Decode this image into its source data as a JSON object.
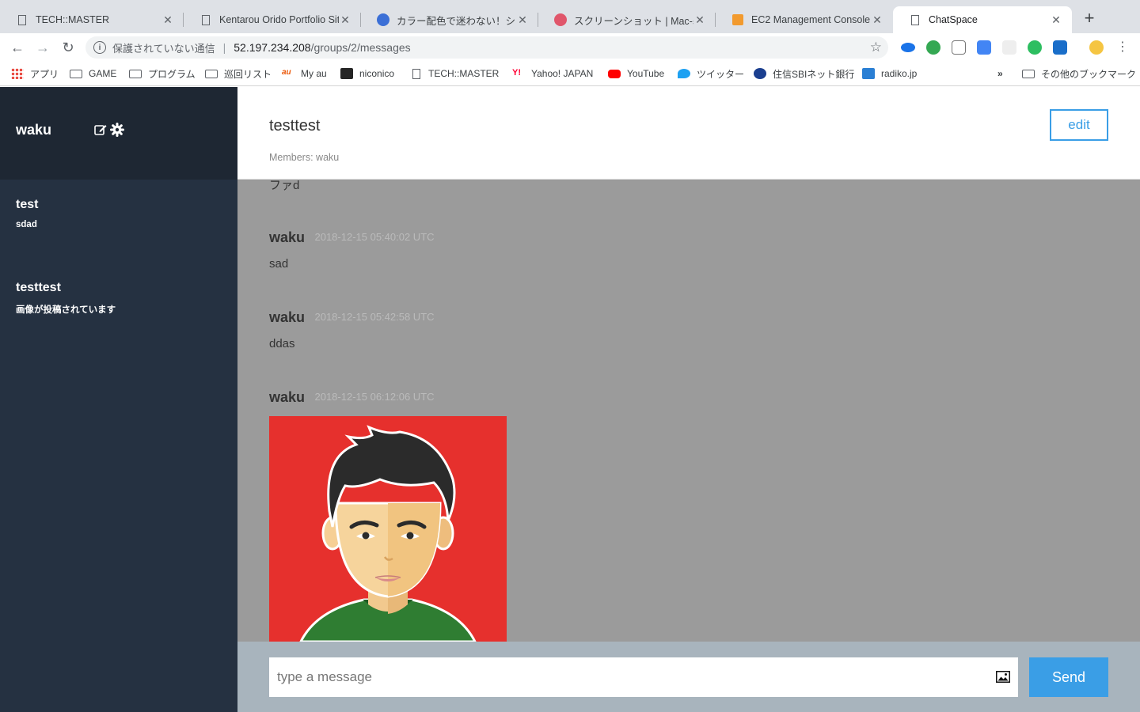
{
  "browser": {
    "tabs": [
      {
        "title": "TECH::MASTER",
        "active": false
      },
      {
        "title": "Kentarou Orido Portfolio Site",
        "active": false
      },
      {
        "title": "カラー配色で迷わない！シーン別",
        "active": false
      },
      {
        "title": "スクリーンショット | Mac-基本",
        "active": false
      },
      {
        "title": "EC2 Management Console",
        "active": false
      },
      {
        "title": "ChatSpace",
        "active": true
      }
    ],
    "security_label": "保護されていない通信",
    "url_host": "52.197.234.208",
    "url_path": "/groups/2/messages",
    "bookmarks": [
      {
        "label": "アプリ",
        "icon": "apps-grid-icon"
      },
      {
        "label": "GAME",
        "icon": "folder-icon"
      },
      {
        "label": "プログラム",
        "icon": "folder-icon"
      },
      {
        "label": "巡回リスト",
        "icon": "folder-icon"
      },
      {
        "label": "My au",
        "icon": "au-icon"
      },
      {
        "label": "niconico",
        "icon": "niconico-icon"
      },
      {
        "label": "TECH::MASTER",
        "icon": "page-icon"
      },
      {
        "label": "Yahoo! JAPAN",
        "icon": "yahoo-icon"
      },
      {
        "label": "YouTube",
        "icon": "youtube-icon"
      },
      {
        "label": "ツイッター",
        "icon": "twitter-icon"
      },
      {
        "label": "住信SBIネット銀行",
        "icon": "bank-icon"
      },
      {
        "label": "radiko.jp",
        "icon": "radiko-icon"
      }
    ],
    "overflow_label": "»",
    "other_bookmarks": "その他のブックマーク"
  },
  "sidebar": {
    "user_name": "waku",
    "groups": [
      {
        "name": "test",
        "last_message": "sdad"
      },
      {
        "name": "testtest",
        "last_message": "画像が投稿されています"
      }
    ]
  },
  "chat": {
    "group_name": "testtest",
    "members_label": "Members: waku",
    "edit_label": "edit",
    "partial_top_text": "ファd",
    "messages": [
      {
        "user": "waku",
        "date": "2018-12-15 05:40:02 UTC",
        "text": "sad"
      },
      {
        "user": "waku",
        "date": "2018-12-15 05:42:58 UTC",
        "text": "ddas"
      },
      {
        "user": "waku",
        "date": "2018-12-15 06:12:06 UTC",
        "text": "",
        "image": "avatar-illustration"
      }
    ],
    "input_placeholder": "type a message",
    "send_label": "Send"
  },
  "colors": {
    "sidebar_bg": "#253141",
    "sidebar_header_bg": "#1e2733",
    "accent": "#3a9ee6",
    "messages_bg": "#9b9b9b",
    "form_bg": "#a8b4bd",
    "image_bg": "#e6302d"
  }
}
